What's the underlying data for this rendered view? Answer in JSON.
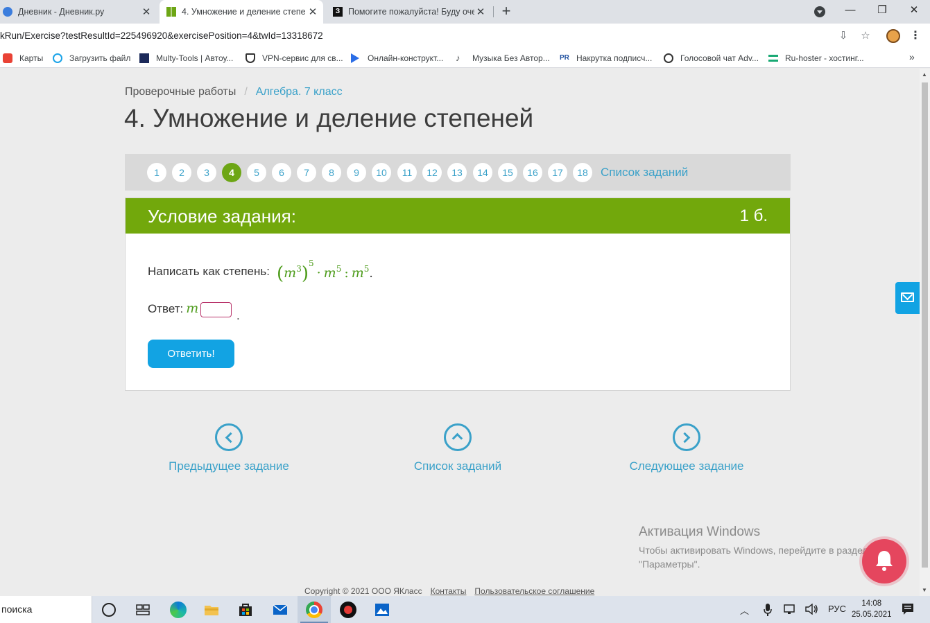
{
  "browser": {
    "tabs": [
      {
        "title": "Дневник - Дневник.ру",
        "active": false
      },
      {
        "title": "4. Умножение и деление степе",
        "active": true
      },
      {
        "title": "Помогите пожалуйста! Буду оче",
        "active": false
      }
    ],
    "new_tab": "+",
    "url": "kRun/Exercise?testResultId=225496920&exercisePosition=4&twId=13318672",
    "window_controls": {
      "minimize": "—",
      "restore": "❐",
      "close": "✕"
    },
    "bookmarks": [
      "Карты",
      "Загрузить файл",
      "Multy-Tools | Автоу...",
      "VPN-сервис для св...",
      "Онлайн-конструкт...",
      "Музыка Без Автор...",
      "Накрутка подписч...",
      "Голосовой чат Adv...",
      "Ru-hoster - хостинг..."
    ],
    "bookmarks_more": "»"
  },
  "page": {
    "breadcrumb": {
      "root": "Проверочные работы",
      "separator": "/",
      "current": "Алгебра. 7 класс"
    },
    "title": "4. Умножение и деление степеней",
    "pager": {
      "numbers": [
        "1",
        "2",
        "3",
        "4",
        "5",
        "6",
        "7",
        "8",
        "9",
        "10",
        "11",
        "12",
        "13",
        "14",
        "15",
        "16",
        "17",
        "18"
      ],
      "active": "4",
      "list_link": "Список заданий"
    },
    "task": {
      "header": "Условие задания:",
      "points": "1 б.",
      "question_label": "Написать как степень:",
      "expression": {
        "base": "m",
        "inner_exp": "3",
        "outer_exp": "5",
        "mul_base": "m",
        "mul_exp": "5",
        "div_base": "m",
        "div_exp": "5",
        "mul_op": "·",
        "div_op": ":",
        "end": "."
      },
      "answer_label": "Ответ:",
      "answer_var": "m",
      "answer_value": "",
      "answer_end": ".",
      "submit": "Ответить!"
    },
    "nav": {
      "prev": "Предыдущее задание",
      "list": "Список заданий",
      "next": "Следующее задание"
    },
    "windows_activation": {
      "title": "Активация Windows",
      "line1": "Чтобы активировать Windows, перейдите в раздел",
      "line2": "\"Параметры\"."
    },
    "footer": {
      "copyright": "Copyright © 2021 ООО ЯКласс",
      "contacts": "Контакты",
      "agreement": "Пользовательское соглашение"
    },
    "colors": {
      "accent_green": "#72a80c",
      "link_blue": "#3aa1c9",
      "button_blue": "#12a3e3",
      "bell_red": "#e5465e"
    }
  },
  "taskbar": {
    "search_text": "поиска",
    "language": "РУС",
    "time": "14:08",
    "date": "25.05.2021"
  }
}
